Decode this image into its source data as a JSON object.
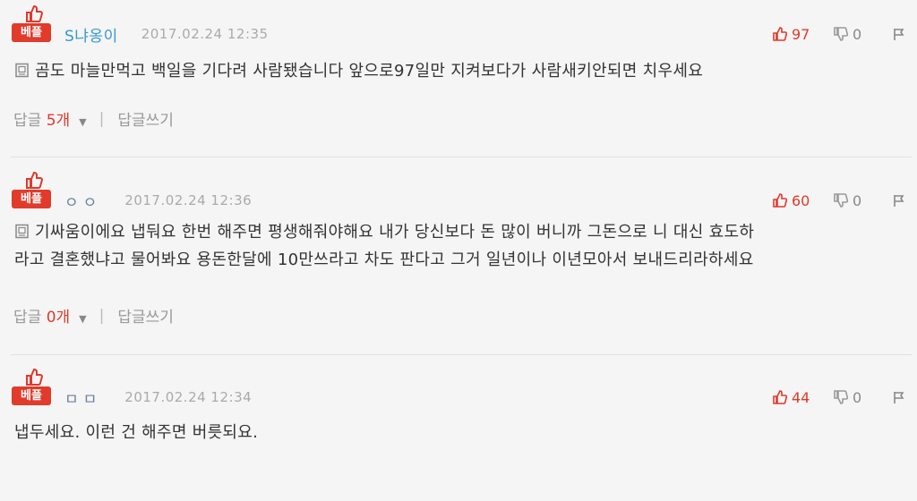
{
  "badge": {
    "label": "베플"
  },
  "reply_write_label": "답글쓰기",
  "reply_prefix": "답글 ",
  "comments": [
    {
      "username": "S냐옹이",
      "timestamp": "2017.02.24 12:35",
      "up": "97",
      "down": "0",
      "body_lines": [
        "곰도 마늘만먹고 백일을 기다려 사람됐습니다 앞으로97일만 지켜보다가 사람새키안되면 치우세요"
      ],
      "reply_count": "5개"
    },
    {
      "username": "ㅇㅇ",
      "timestamp": "2017.02.24 12:36",
      "up": "60",
      "down": "0",
      "body_lines": [
        "기싸움이에요 냅둬요 한번 해주면 평생해줘야해요 내가 당신보다 돈 많이 버니까 그돈으로 니 대신 효도하",
        "라고 결혼했냐고 물어봐요 용돈한달에 10만쓰라고 차도 판다고 그거 일년이나 이년모아서 보내드리라하세요"
      ],
      "reply_count": "0개"
    },
    {
      "username": "ㅁㅁ",
      "timestamp": "2017.02.24 12:34",
      "up": "44",
      "down": "0",
      "body_lines": [
        "냅두세요. 이런 건 해주면 버릇되요."
      ]
    }
  ],
  "colors": {
    "accent": "#e13b2c",
    "username_blue": "#3399cc"
  }
}
